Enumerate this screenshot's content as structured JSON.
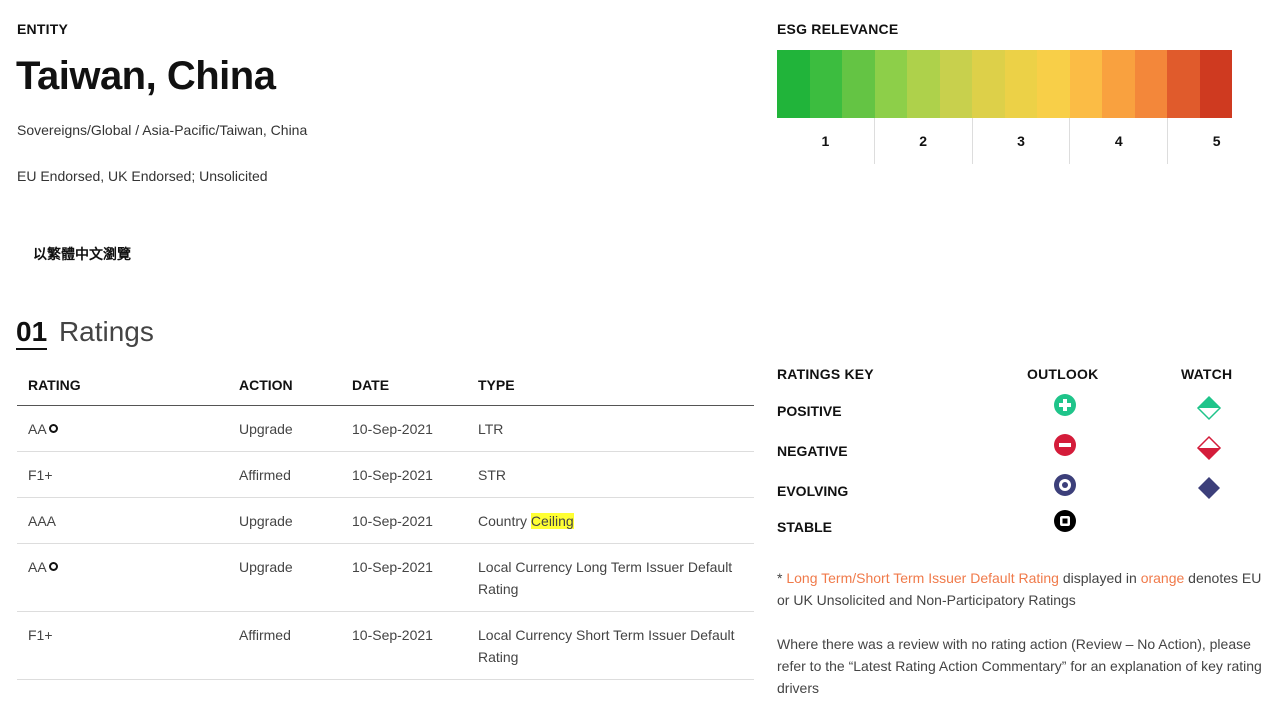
{
  "entity": {
    "label": "ENTITY",
    "name": "Taiwan, China",
    "path": "Sovereigns/Global / Asia-Pacific/Taiwan, China",
    "endorsement": "EU Endorsed, UK Endorsed; Unsolicited",
    "language_link": "以繁體中文瀏覽"
  },
  "ratings_section": {
    "number": "01",
    "title": "Ratings",
    "columns": [
      "RATING",
      "ACTION",
      "DATE",
      "TYPE"
    ],
    "rows": [
      {
        "rating": "AA",
        "evolving": true,
        "action": "Upgrade",
        "date": "10-Sep-2021",
        "type": "LTR",
        "type_highlight": ""
      },
      {
        "rating": "F1+",
        "evolving": false,
        "action": "Affirmed",
        "date": "10-Sep-2021",
        "type": "STR",
        "type_highlight": ""
      },
      {
        "rating": "AAA",
        "evolving": false,
        "action": "Upgrade",
        "date": "10-Sep-2021",
        "type": "Country ",
        "type_highlight": "Ceiling"
      },
      {
        "rating": "AA",
        "evolving": true,
        "action": "Upgrade",
        "date": "10-Sep-2021",
        "type": "Local Currency Long Term Issuer Default Rating",
        "type_highlight": ""
      },
      {
        "rating": "F1+",
        "evolving": false,
        "action": "Affirmed",
        "date": "10-Sep-2021",
        "type": "Local Currency Short Term Issuer Default Rating",
        "type_highlight": ""
      }
    ]
  },
  "esg": {
    "label": "ESG RELEVANCE",
    "colors": [
      "#21b43a",
      "#3cbd3f",
      "#64c444",
      "#8dcf49",
      "#aed14b",
      "#c8d04d",
      "#ddd049",
      "#ecd147",
      "#f8cf48",
      "#fbbc45",
      "#f9a13f",
      "#f3873a",
      "#e05b2c",
      "#cf3a20",
      "#ffffff"
    ],
    "scale": [
      "1",
      "2",
      "3",
      "4",
      "5"
    ]
  },
  "ratings_key": {
    "label": "RATINGS KEY",
    "outlook_label": "OUTLOOK",
    "watch_label": "WATCH",
    "rows": [
      {
        "label": "POSITIVE",
        "outlook_icon": "positive-plus-icon",
        "watch_icon": "watch-positive-diamond-icon",
        "color": "#1fc48a"
      },
      {
        "label": "NEGATIVE",
        "outlook_icon": "negative-minus-icon",
        "watch_icon": "watch-negative-diamond-icon",
        "color": "#d41c3a"
      },
      {
        "label": "EVOLVING",
        "outlook_icon": "evolving-dot-icon",
        "watch_icon": "watch-evolving-diamond-icon",
        "color": "#3c3f7a"
      },
      {
        "label": "STABLE",
        "outlook_icon": "stable-square-icon",
        "watch_icon": "",
        "color": "#000000"
      }
    ]
  },
  "footnotes": {
    "note1_prefix": "* ",
    "note1_orange1": "Long Term/Short Term Issuer Default Rating",
    "note1_mid": " displayed in ",
    "note1_orange2": "orange",
    "note1_suffix": " denotes EU or UK Unsolicited and Non-Participatory Ratings",
    "note2": "Where there was a review with no rating action (Review – No Action), please refer to the “Latest Rating Action Commentary” for an explanation of key rating drivers"
  }
}
